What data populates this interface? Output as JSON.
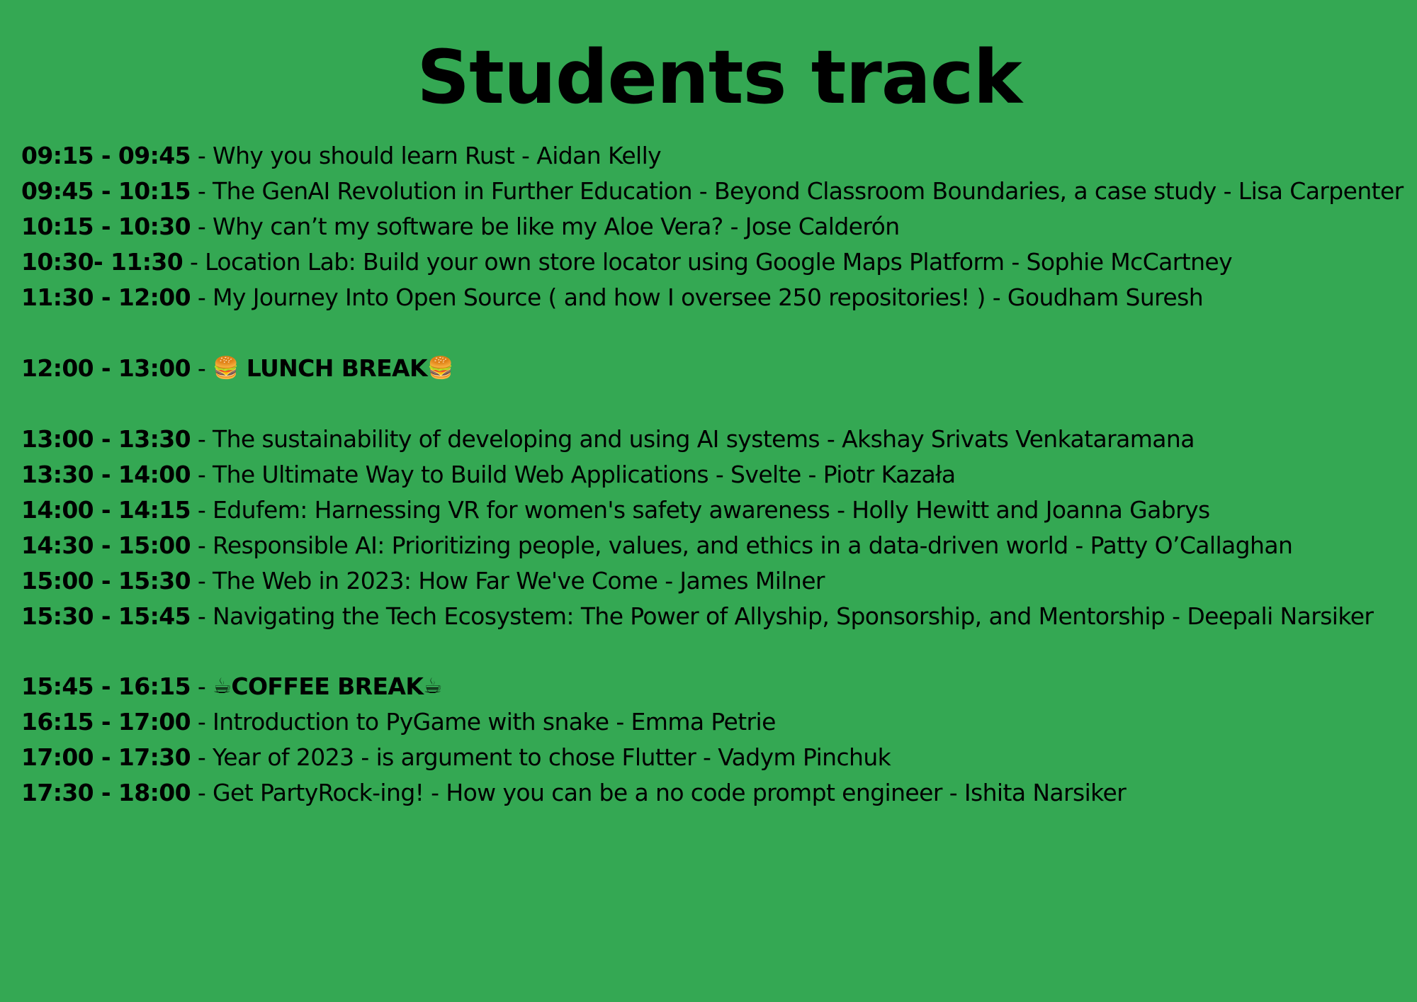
{
  "slide": {
    "title": "Students track",
    "background": "#34a853"
  },
  "schedule": [
    {
      "time": "09:15 - 09:45",
      "text": " - Why you should learn Rust - Aidan Kelly"
    },
    {
      "time": "09:45 - 10:15",
      "text": " - The GenAI Revolution in Further Education - Beyond Classroom Boundaries, a case study - Lisa Carpenter"
    },
    {
      "time": "10:15 - 10:30",
      "text": " - Why can’t my software be like my Aloe Vera? - Jose Calderón"
    },
    {
      "time": "10:30- 11:30",
      "text": " - Location Lab: Build your own store locator using Google Maps Platform - Sophie McCartney"
    },
    {
      "time": "11:30 - 12:00",
      "text": " - My Journey Into Open Source ( and how I oversee 250 repositories! ) - Goudham Suresh"
    },
    {
      "time": "12:00 - 13:00",
      "sep": " - ",
      "emoji_before": "🍔",
      "label": " LUNCH BREAK",
      "emoji_after": "🍔"
    },
    {
      "time": "13:00 - 13:30",
      "text": " - The sustainability of developing and using AI systems - Akshay Srivats Venkataramana"
    },
    {
      "time": "13:30 - 14:00",
      "text": " - The Ultimate Way to Build Web Applications - Svelte - Piotr Kazała"
    },
    {
      "time": "14:00 - 14:15",
      "text": " - Edufem: Harnessing VR for women's safety awareness - Holly Hewitt and Joanna Gabrys"
    },
    {
      "time": "14:30 - 15:00",
      "text": " - Responsible AI: Prioritizing people, values, and ethics in a data-driven world - Patty O’Callaghan"
    },
    {
      "time": "15:00 - 15:30",
      "text": " - The Web in 2023: How Far We've Come - James Milner"
    },
    {
      "time": "15:30 - 15:45",
      "text": " - Navigating the Tech Ecosystem: The Power of Allyship, Sponsorship, and Mentorship - Deepali Narsiker"
    },
    {
      "time": "15:45 - 16:15",
      "sep": " - ",
      "emoji_before": "☕",
      "label": "COFFEE BREAK",
      "emoji_after": "☕"
    },
    {
      "time": "16:15 - 17:00",
      "text": " - Introduction to PyGame with snake - Emma Petrie"
    },
    {
      "time": "17:00 - 17:30",
      "text": " - Year of 2023 - is argument to chose Flutter - Vadym Pinchuk"
    },
    {
      "time": "17:30 - 18:00",
      "text": " - Get PartyRock-ing! - How you can be a no code prompt engineer - Ishita Narsiker"
    }
  ]
}
